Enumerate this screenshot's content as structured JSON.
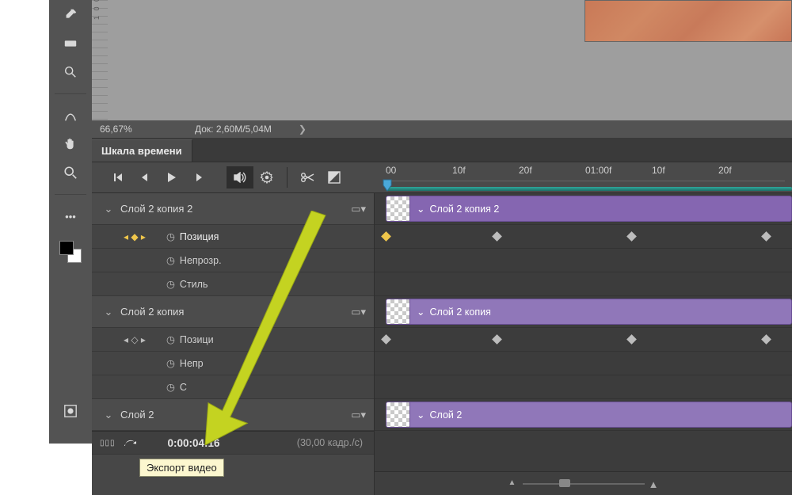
{
  "status": {
    "zoom": "66,67%",
    "doc": "Док: 2,60M/5,04M"
  },
  "panel": {
    "title": "Шкала времени"
  },
  "controls": {
    "first": "first-frame",
    "prev": "prev-frame",
    "play": "play",
    "next": "next-frame",
    "mute": "audio",
    "settings": "settings",
    "split": "split-clip",
    "transition": "transition"
  },
  "ruler": {
    "ticks": [
      "00",
      "10f",
      "20f",
      "01:00f",
      "10f",
      "20f"
    ]
  },
  "layers": [
    {
      "name": "Слой 2 копия 2",
      "clip_label": "Слой 2 копия 2",
      "props": [
        {
          "label": "Позиция",
          "has_gold_key": true
        },
        {
          "label": "Непрозр."
        },
        {
          "label": "Стиль"
        }
      ]
    },
    {
      "name": "Слой 2 копия",
      "clip_label": "Слой 2 копия",
      "props": [
        {
          "label": "Позиция"
        },
        {
          "label": "Непрозр."
        },
        {
          "label": "Стиль",
          "truncated": "С"
        }
      ]
    },
    {
      "name": "Слой 2",
      "clip_label": "Слой 2",
      "props": []
    }
  ],
  "footer": {
    "time": "0:00:04:16",
    "fps": "(30,00 кадр./c)"
  },
  "tooltip": "Экспорт видео",
  "labels": {
    "prop_position_trunc": "Позици",
    "prop_opacity_trunc": "Непр"
  }
}
